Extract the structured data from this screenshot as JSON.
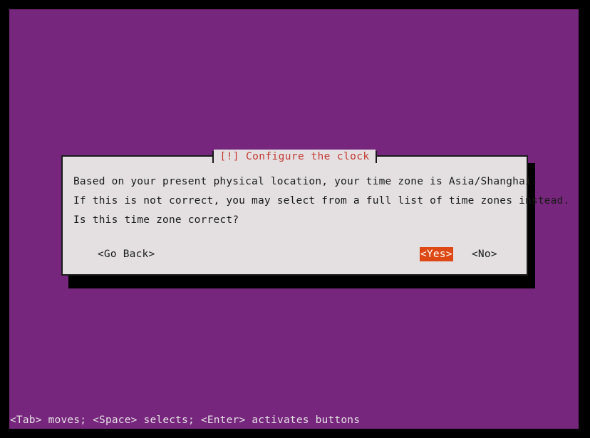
{
  "screen": {
    "background_color": "#000000",
    "desktop_color": "#76267c"
  },
  "dialog": {
    "title": "[!] Configure the clock",
    "title_color": "#c33a33",
    "background_color": "#e4e0e2",
    "border_color": "#1b1b1b",
    "lines": [
      "Based on your present physical location, your time zone is Asia/Shanghai.",
      "If this is not correct, you may select from a full list of time zones instead.",
      "Is this time zone correct?"
    ],
    "buttons": [
      {
        "label": "<Go Back>",
        "selected": false
      },
      {
        "label": "<Yes>",
        "selected": true
      },
      {
        "label": "<No>",
        "selected": false
      }
    ],
    "selected_color": "#dd4814"
  },
  "statusbar": {
    "text": "<Tab> moves; <Space> selects; <Enter> activates buttons"
  }
}
